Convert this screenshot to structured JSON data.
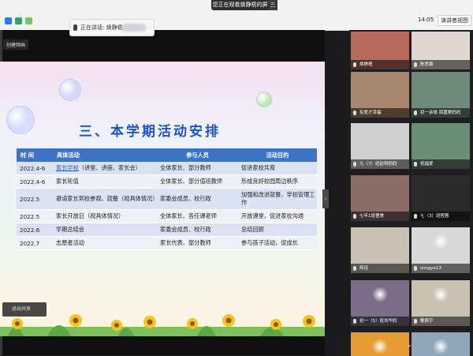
{
  "topbar": {
    "sharing_text": "您正在观看焕静梧的屏幕",
    "sharing_menu": "三",
    "time": "14:05",
    "gallery_label": "演讲者视图",
    "speaking_prefix": "正在讲话: 焕静梧;"
  },
  "left_panel": {
    "control_tag": "创建频画",
    "stop_share": "退出共享"
  },
  "slide": {
    "title": "三、本学期活动安排",
    "columns": [
      "时 间",
      "具体活动",
      "参与人员",
      "活动目的"
    ],
    "rows": [
      {
        "time": "2022.4-6",
        "activity_link": "家长学校",
        "activity": "（讲堂、讲座、家长会）",
        "people": "全体家长、部分教师",
        "purpose": "促进家校共育"
      },
      {
        "time": "2022.4-6",
        "activity_link": "",
        "activity": "家长轮值",
        "people": "全体家长、部分值班教师",
        "purpose": "形成良好校园周边秩序"
      },
      {
        "time": "2022.5",
        "activity_link": "",
        "activity": "邀请家长到校参观、就餐（视具体情况）",
        "people": "家委会成员、校行政",
        "purpose": "加强和改进就餐、学校管理工作"
      },
      {
        "time": "2022.5",
        "activity_link": "",
        "activity": "家长开放日（视具体情况）",
        "people": "全体家长、各任课老师",
        "purpose": "开放课堂，促进家校沟通"
      },
      {
        "time": "2022.6",
        "activity_link": "",
        "activity": "学期总结会",
        "people": "家委会成员、校行政",
        "purpose": "总结回顾"
      },
      {
        "time": "2022.7",
        "activity_link": "",
        "activity": "志愿者活动",
        "people": "家长代表、部分教师",
        "purpose": "参与孩子活动，促成长"
      }
    ]
  },
  "participants": [
    {
      "name": "焕静梧",
      "icon": "person",
      "color": "#b86a5c"
    },
    {
      "name": "陈思睿",
      "icon": "person",
      "color": "#e0d7d0"
    },
    {
      "name": "有爱才幸福",
      "icon": "person",
      "color": "#a88770"
    },
    {
      "name": "初一余晗 周嘉栗妈妈",
      "icon": "person",
      "color": "#6f8a7a"
    },
    {
      "name": "九（7）班赵明妈妈",
      "icon": "person",
      "color": "#cfcfcf"
    },
    {
      "name": "祝福爱",
      "icon": "person",
      "color": "#6a8d78"
    },
    {
      "name": "七年1班曹美",
      "icon": "person",
      "color": "#8a6d69"
    },
    {
      "name": "七（3）班程蓉",
      "icon": "person",
      "color": "#2a2a2a"
    },
    {
      "name": "辉远",
      "icon": "person",
      "color": "#c8c0b4"
    },
    {
      "name": "songya13",
      "icon": "flower-avatar",
      "color": "#d8d8d8"
    },
    {
      "name": "初一（5）班刘华妈",
      "icon": "cat-avatar",
      "color": "#7d6c88"
    },
    {
      "name": "戴佩宇",
      "icon": "child-avatar",
      "color": "#c9c2b3"
    },
    {
      "name": "",
      "icon": "orange-avatar",
      "color": "#e69a34"
    },
    {
      "name": "",
      "icon": "child-avatar",
      "color": "#8fa7b8"
    }
  ]
}
